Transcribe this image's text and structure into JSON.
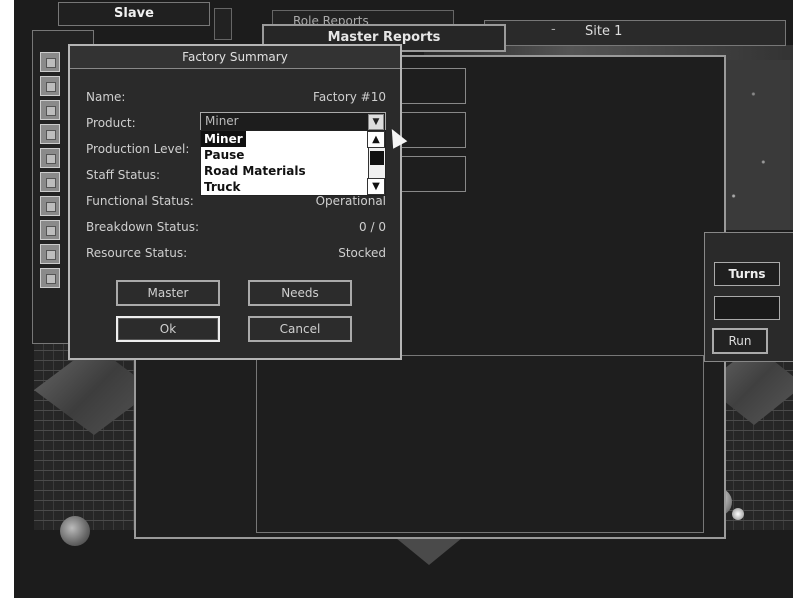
{
  "tabs": {
    "slave": "Slave",
    "role_partial": "Role Reports",
    "master_reports": "Master Reports",
    "site_dash": "-",
    "site": "Site 1"
  },
  "right_panel": {
    "turns_label": "Turns",
    "turns_value": "",
    "run_label": "Run"
  },
  "dialog": {
    "title": "Factory Summary",
    "fields": [
      {
        "label": "Name:",
        "value": "Factory #10"
      },
      {
        "label": "Product:",
        "value": "Miner"
      },
      {
        "label": "Production Level:",
        "value": ""
      },
      {
        "label": "Staff Status:",
        "value": ""
      },
      {
        "label": "Functional Status:",
        "value": "Operational"
      },
      {
        "label": "Breakdown Status:",
        "value": "0 / 0"
      },
      {
        "label": "Resource Status:",
        "value": "Stocked"
      }
    ],
    "product_dropdown": {
      "selected": "Miner",
      "options": [
        "Miner",
        "Pause",
        "Road Materials",
        "Truck"
      ]
    },
    "buttons": {
      "master": "Master",
      "needs": "Needs",
      "ok": "Ok",
      "cancel": "Cancel"
    }
  },
  "colors": {
    "background": "#1c1c1c",
    "dialog_bg": "#2a2a2a",
    "dropdown_bg": "#ffffff",
    "border": "#9a9a9a"
  }
}
